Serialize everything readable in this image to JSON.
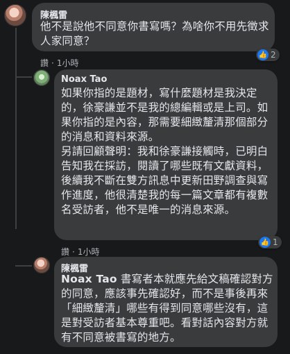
{
  "comments": [
    {
      "author": "陳楓雷",
      "text": "他不是說他不同意你書寫嗎？為啥你不用先徵求人家同意？",
      "action_label": "讚",
      "time": "1小時",
      "reaction_count": "2"
    },
    {
      "author": "Noax Tao",
      "text": "如果你指的是題材，寫什麼題材是我決定的，徐豪謙並不是我的總編輯或是上司。如果你指的是內容，那需要細緻釐清那個部分的消息和資料來源。\n另請回顧聲明：我和徐豪謙接觸時，已明白告知我在採訪，閱讀了哪些既有文獻資料，後續我不斷在雙方訊息中更新田野調查與寫作進度，他很清楚我的每一篇文章都有複數名受訪者，他不是唯一的消息來源。",
      "action_label": "讚",
      "time": "1小時",
      "reaction_count": "1"
    },
    {
      "author": "陳楓雷",
      "mention": "Noax Tao",
      "text": " 書寫者本就應先給文稿確認對方的同意，應該事先確認好，而不是事後再來「細緻釐清」哪些有得到同意哪些沒有，這是對受訪者基本尊重吧。看對話內容對方就有不同意被書寫的地方。"
    }
  ]
}
